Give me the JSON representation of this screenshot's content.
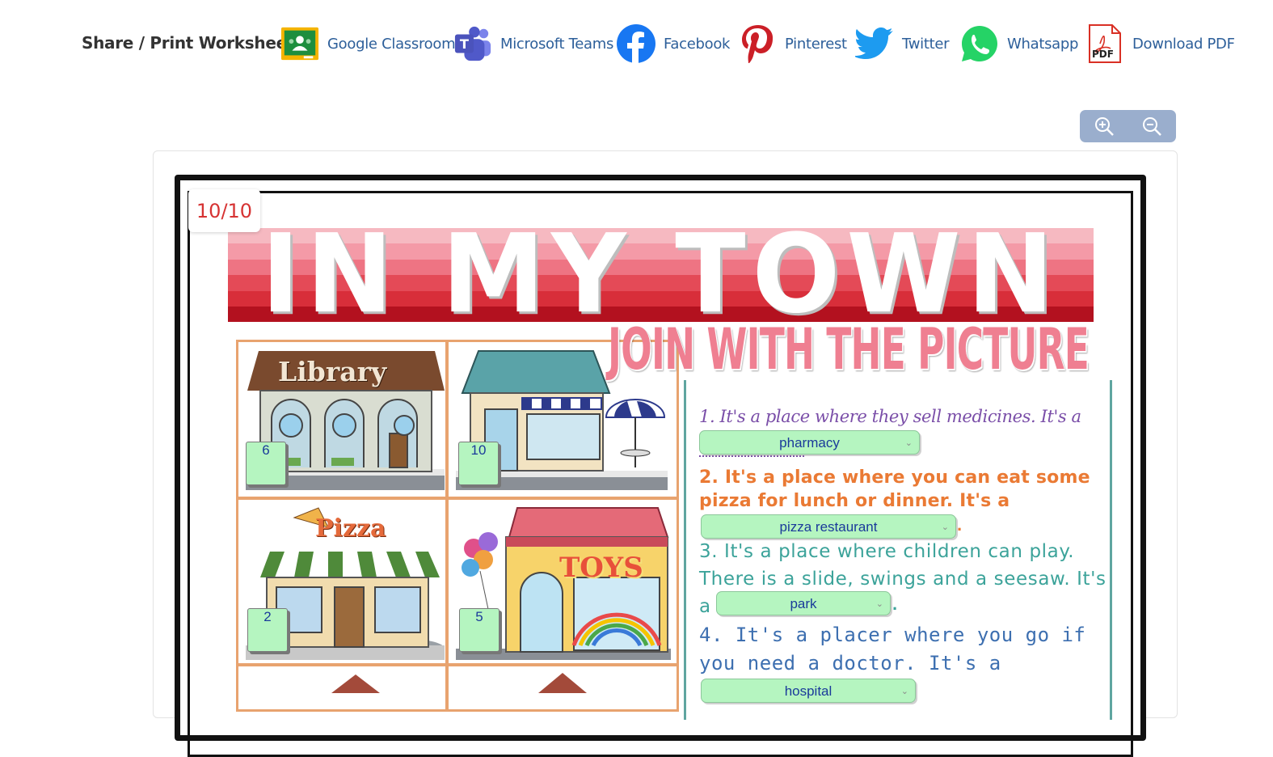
{
  "share": {
    "title": "Share / Print Worksheet",
    "items": [
      {
        "label": "Google Classroom",
        "icon": "google-classroom-icon"
      },
      {
        "label": "Microsoft Teams",
        "icon": "microsoft-teams-icon"
      },
      {
        "label": "Facebook",
        "icon": "facebook-icon"
      },
      {
        "label": "Pinterest",
        "icon": "pinterest-icon"
      },
      {
        "label": "Twitter",
        "icon": "twitter-icon"
      },
      {
        "label": "Whatsapp",
        "icon": "whatsapp-icon"
      },
      {
        "label": "Download PDF",
        "icon": "pdf-icon"
      }
    ],
    "pdf_badge": "PDF"
  },
  "zoom": {
    "in_icon": "zoom-in-icon",
    "out_icon": "zoom-out-icon"
  },
  "worksheet": {
    "score": "10/10",
    "title": "IN MY TOWN",
    "subtitle": "JOIN WITH THE PICTURE",
    "pictures": [
      {
        "label": "Library",
        "answer": "6"
      },
      {
        "label": "",
        "answer": "10"
      },
      {
        "label": "Pizza",
        "answer": "2"
      },
      {
        "label": "TOYS",
        "answer": "5"
      }
    ],
    "questions": [
      {
        "line1": "1. It's a place where they sell medicines. It's a",
        "answer": "pharmacy"
      },
      {
        "line1": "2. It's a place where you can eat some",
        "line2": "pizza for lunch or dinner. It's a",
        "answer": "pizza restaurant",
        "suffix": "."
      },
      {
        "line1": "3. It's a place where children can play.",
        "line2": "There is a slide, swings and a seesaw. It's",
        "prefix": "a",
        "answer": "park",
        "suffix": "."
      },
      {
        "line1": "4. It's a placer where you go if",
        "line2": "you need a doctor. It's a",
        "answer": "hospital"
      }
    ]
  },
  "colors": {
    "link": "#2d5f9a",
    "answer_bg": "#b5f5c0",
    "banner_stripes": [
      "#f6b9c1",
      "#f49aa7",
      "#ee7483",
      "#e44a57",
      "#d82e3a",
      "#b3111f"
    ]
  }
}
